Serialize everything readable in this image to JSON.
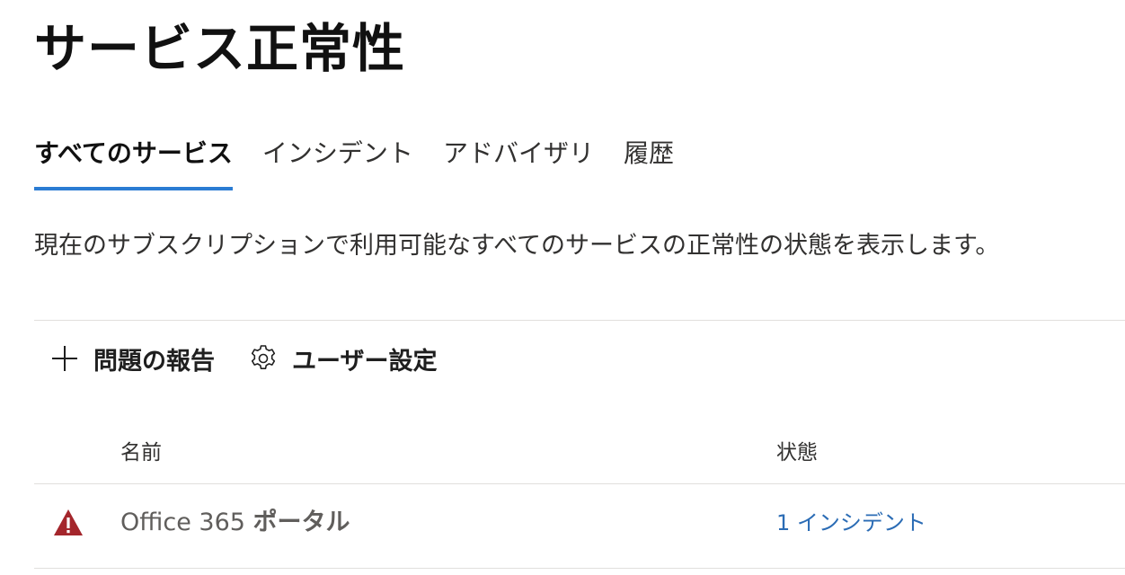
{
  "page": {
    "title": "サービス正常性",
    "description": "現在のサブスクリプションで利用可能なすべてのサービスの正常性の状態を表示します。"
  },
  "tabs": [
    {
      "label": "すべてのサービス",
      "active": true
    },
    {
      "label": "インシデント",
      "active": false
    },
    {
      "label": "アドバイザリ",
      "active": false
    },
    {
      "label": "履歴",
      "active": false
    }
  ],
  "toolbar": {
    "report_issue": {
      "label": "問題の報告",
      "icon": "plus-icon"
    },
    "user_settings": {
      "label": "ユーザー設定",
      "icon": "gear-icon"
    }
  },
  "table": {
    "columns": {
      "name": "名前",
      "status": "状態"
    },
    "rows": [
      {
        "status_icon": "warning-icon",
        "name_prefix": "Office 365 ",
        "name_suffix": "ポータル",
        "status": "1 インシデント"
      }
    ]
  },
  "colors": {
    "accent": "#2b7cd3",
    "link": "#2b6cb5",
    "warning": "#a4262c"
  }
}
